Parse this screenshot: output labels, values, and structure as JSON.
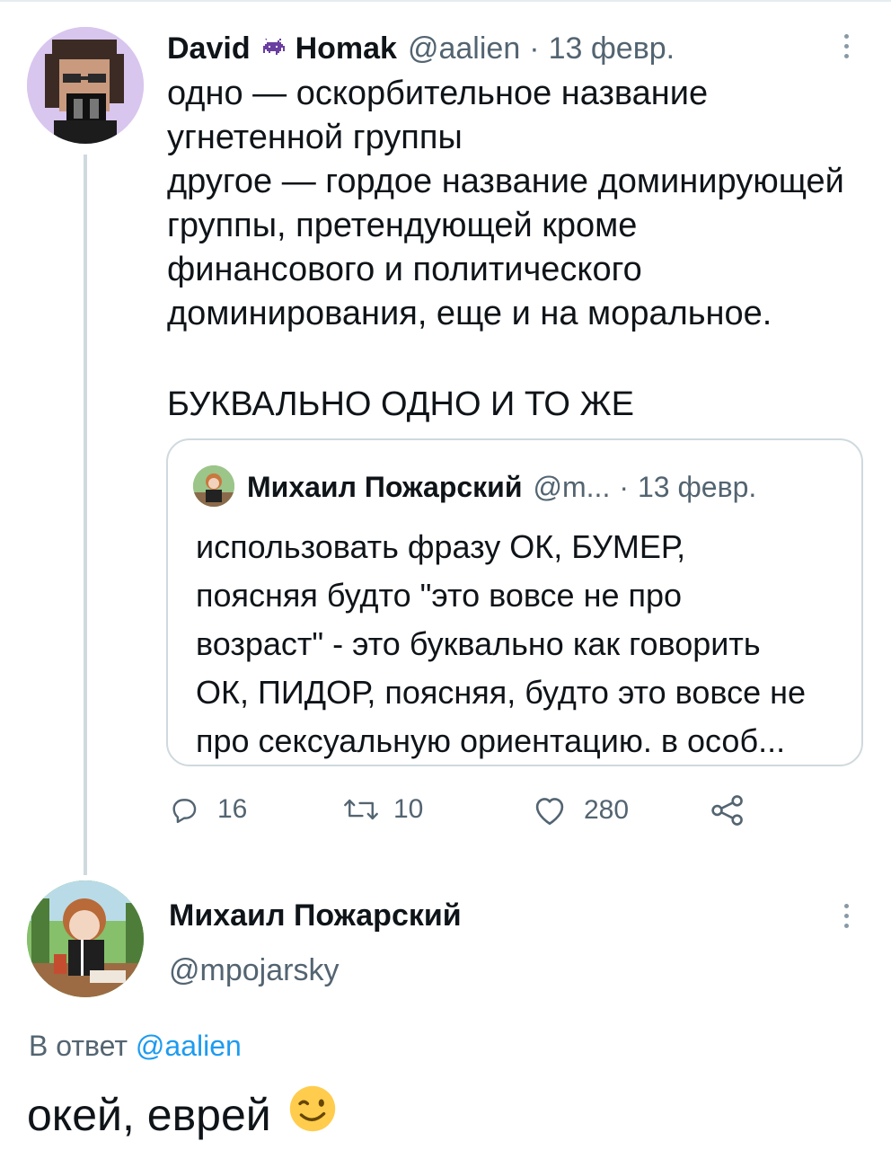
{
  "tweet": {
    "author_name": "David",
    "author_name_suffix": "Homak",
    "author_handle": "@aalien",
    "separator": "·",
    "date": "13 февр.",
    "lines": [
      "одно — оскорбительное название",
      "угнетенной группы",
      "другое — гордое название доминирующей",
      "группы, претендующей кроме",
      "финансового и политического",
      "доминирования, еще и на моральное."
    ],
    "emphasis": "БУКВАЛЬНО ОДНО И ТО ЖЕ",
    "quote": {
      "author_name": "Михаил Пожарский",
      "author_handle": "@m...",
      "separator": "·",
      "date": "13 февр.",
      "lines": [
        "использовать фразу ОК, БУМЕР,",
        "поясняя будто \"это вовсе не про",
        "возраст\" - это буквально как говорить",
        "ОК, ПИДОР, поясняя, будто это вовсе не",
        "про сексуальную ориентацию. в особ..."
      ]
    },
    "actions": {
      "reply_count": "16",
      "retweet_count": "10",
      "like_count": "280"
    }
  },
  "reply": {
    "author_name": "Михаил Пожарский",
    "author_handle": "@mpojarsky",
    "reply_prefix": "В ответ",
    "reply_to": "@aalien",
    "text": "окей, еврей",
    "emoji": "😉"
  },
  "colors": {
    "text": "#0f1419",
    "secondary": "#536471",
    "link": "#1d9bf0",
    "border": "#cfd9de",
    "avatar_bg": "#d8c6ee"
  }
}
